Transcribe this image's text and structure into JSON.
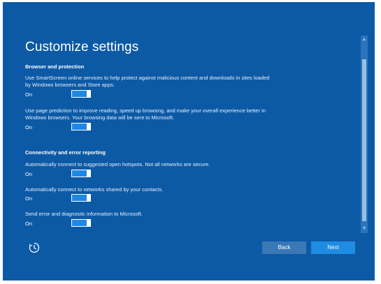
{
  "page": {
    "title": "Customize settings"
  },
  "sections": {
    "browser": {
      "heading": "Browser and protection",
      "smartscreen": {
        "description": "Use SmartScreen online services to help protect against malicious content and downloads in sites loaded by Windows browsers and Store apps.",
        "state": "On"
      },
      "prediction": {
        "description": "Use page prediction to improve reading, speed up browsing, and make your overall experience better in Windows browsers. Your browsing data will be sent to Microsoft.",
        "state": "On"
      }
    },
    "connectivity": {
      "heading": "Connectivity and error reporting",
      "hotspots": {
        "description": "Automatically connect to suggested open hotspots. Not all networks are secure.",
        "state": "On"
      },
      "contacts": {
        "description": "Automatically connect to networks shared by your contacts.",
        "state": "On"
      },
      "diagnostics": {
        "description": "Send error and diagnostic information to Microsoft.",
        "state": "On"
      }
    }
  },
  "footer": {
    "ease_icon": "ease-of-access-icon",
    "back_label": "Back",
    "next_label": "Next"
  },
  "colors": {
    "background": "#0c5aa6",
    "toggle_on": "#1e88e5",
    "next_button": "#1e8ce0",
    "back_button": "#3a78b6"
  }
}
